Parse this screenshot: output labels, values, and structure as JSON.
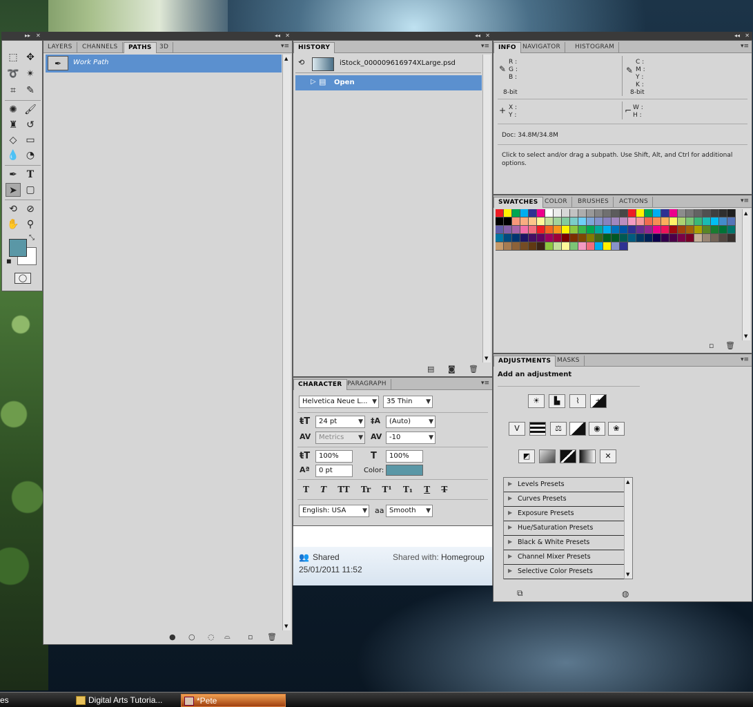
{
  "tools": {
    "fg_color": "#5a97a6",
    "bg_color": "#ffffff",
    "items": [
      "rectangular-marquee",
      "move",
      "lasso",
      "magic-wand",
      "crop",
      "eyedropper",
      "spot-healing",
      "brush",
      "clone-stamp",
      "history-brush",
      "eraser",
      "gradient",
      "blur",
      "dodge",
      "pen",
      "type",
      "path-selection",
      "shape",
      "3d-rotate",
      "3d-orbit",
      "hand",
      "zoom"
    ]
  },
  "paths_panel": {
    "tabs": [
      "LAYERS",
      "CHANNELS",
      "PATHS",
      "3D"
    ],
    "active_tab": "PATHS",
    "rows": [
      {
        "name": "Work Path",
        "selected": true
      }
    ]
  },
  "history_panel": {
    "tab": "HISTORY",
    "snapshot_name": "iStock_000009616974XLarge.psd",
    "states": [
      {
        "name": "Open",
        "selected": true
      }
    ]
  },
  "character_panel": {
    "tabs": [
      "CHARACTER",
      "PARAGRAPH"
    ],
    "active_tab": "CHARACTER",
    "font_family": "Helvetica Neue L...",
    "font_style": "35 Thin",
    "font_size": "24 pt",
    "leading": "(Auto)",
    "kerning": "Metrics",
    "tracking": "-10",
    "vertical_scale": "100%",
    "horizontal_scale": "100%",
    "baseline_shift": "0 pt",
    "color_label": "Color:",
    "color_value": "#5a97a6",
    "language": "English: USA",
    "anti_alias_label": "aa",
    "anti_alias": "Smooth",
    "type_styles": [
      "T",
      "T",
      "TT",
      "Tr",
      "T¹",
      "T₁",
      "T",
      "T"
    ]
  },
  "explorer_strip": {
    "shared_label": "Shared",
    "shared_with_label": "Shared with:",
    "shared_with_value": "Homegroup",
    "date": "25/01/2011 11:52"
  },
  "info_panel": {
    "tabs": [
      "INFO",
      "NAVIGATOR",
      "HISTOGRAM"
    ],
    "active_tab": "INFO",
    "rgb_labels": [
      "R :",
      "G :",
      "B :"
    ],
    "cmyk_labels": [
      "C :",
      "M :",
      "Y :",
      "K :"
    ],
    "bit_left": "8-bit",
    "bit_right": "8-bit",
    "xy_labels": [
      "X :",
      "Y :"
    ],
    "wh_labels": [
      "W :",
      "H :"
    ],
    "doc": "Doc: 34.8M/34.8M",
    "hint": "Click to select and/or drag a subpath.  Use Shift, Alt, and Ctrl for additional options."
  },
  "swatches_panel": {
    "tabs": [
      "SWATCHES",
      "COLOR",
      "BRUSHES",
      "ACTIONS"
    ],
    "active_tab": "SWATCHES",
    "rows": [
      [
        "#ed1c24",
        "#fff200",
        "#00a651",
        "#00aeef",
        "#2e3192",
        "#ec008c",
        "#ffffff",
        "#ebebeb",
        "#d7d7d7",
        "#c2c2c2",
        "#adadad",
        "#999999",
        "#858585",
        "#707070",
        "#5c5c5c",
        "#474747",
        "#ed1c24",
        "#fff200",
        "#00a651",
        "#00aeef",
        "#2e3192",
        "#ec008c",
        "#8c8c8c",
        "#777777",
        "#636363",
        "#505050",
        "#3f3f3f",
        "#2f2f2f",
        "#1f1f1f"
      ],
      [
        "#000000",
        "#000000",
        "#f7977a",
        "#f9ad81",
        "#fdc68a",
        "#fff79a",
        "#c4df9b",
        "#a2d39c",
        "#82ca9d",
        "#7bcdc8",
        "#6ecff6",
        "#7ea7d8",
        "#8493ca",
        "#8882be",
        "#a187be",
        "#bc8dbf",
        "#f49ac2",
        "#f6989d",
        "#f26c4f",
        "#f68e55",
        "#fbaf5c",
        "#fff467",
        "#acd372",
        "#7cc576",
        "#3bb878",
        "#1abbb4",
        "#00bff3",
        "#438ccb",
        "#5574b9"
      ],
      [
        "#605ca8",
        "#855fa8",
        "#a763a8",
        "#f06ea9",
        "#f26d7d",
        "#ed1c24",
        "#f26522",
        "#f7941d",
        "#fff200",
        "#8dc73f",
        "#39b54a",
        "#00a651",
        "#00a99d",
        "#00aeef",
        "#0072bc",
        "#0054a6",
        "#2e3192",
        "#662d91",
        "#92278f",
        "#ec008c",
        "#ed145b",
        "#9e0b0f",
        "#a0410d",
        "#a36209",
        "#aba000",
        "#598527",
        "#1a7b30",
        "#007236",
        "#00746b"
      ],
      [
        "#0076a3",
        "#004a80",
        "#003471",
        "#1b1464",
        "#440e62",
        "#630460",
        "#9e005d",
        "#9e0039",
        "#790000",
        "#7b2e00",
        "#7d4900",
        "#827b00",
        "#406618",
        "#005e20",
        "#005826",
        "#005952",
        "#005b7f",
        "#003663",
        "#002157",
        "#0d004c",
        "#32004b",
        "#4b0049",
        "#7b0046",
        "#7a0026",
        "#c7b299",
        "#998675",
        "#736357",
        "#534741",
        "#37302d"
      ],
      [
        "#c69c6d",
        "#a67c52",
        "#8c6239",
        "#754c24",
        "#603913",
        "#3c2415",
        "#8dc73f",
        "#c4df9b",
        "#fff79a",
        "#7cc576",
        "#f49ac2",
        "#f26d7d",
        "#00aeef",
        "#fff200",
        "#8893ca",
        "#2e3192"
      ]
    ]
  },
  "adjustments_panel": {
    "tabs": [
      "ADJUSTMENTS",
      "MASKS"
    ],
    "active_tab": "ADJUSTMENTS",
    "title": "Add an adjustment",
    "icons_row1": [
      "brightness-contrast",
      "levels",
      "curves",
      "exposure"
    ],
    "icons_row2": [
      "vibrance",
      "hue-saturation",
      "color-balance",
      "black-white",
      "photo-filter",
      "channel-mixer"
    ],
    "icons_row3": [
      "invert",
      "posterize",
      "threshold",
      "gradient-map",
      "selective-color"
    ],
    "presets": [
      "Levels Presets",
      "Curves Presets",
      "Exposure Presets",
      "Hue/Saturation Presets",
      "Black & White Presets",
      "Channel Mixer Presets",
      "Selective Color Presets"
    ]
  },
  "taskbar": {
    "left_stub": "es",
    "items": [
      {
        "label": "Digital Arts Tutoria...",
        "active": false
      },
      {
        "label": "*Pete",
        "active": true
      }
    ]
  }
}
